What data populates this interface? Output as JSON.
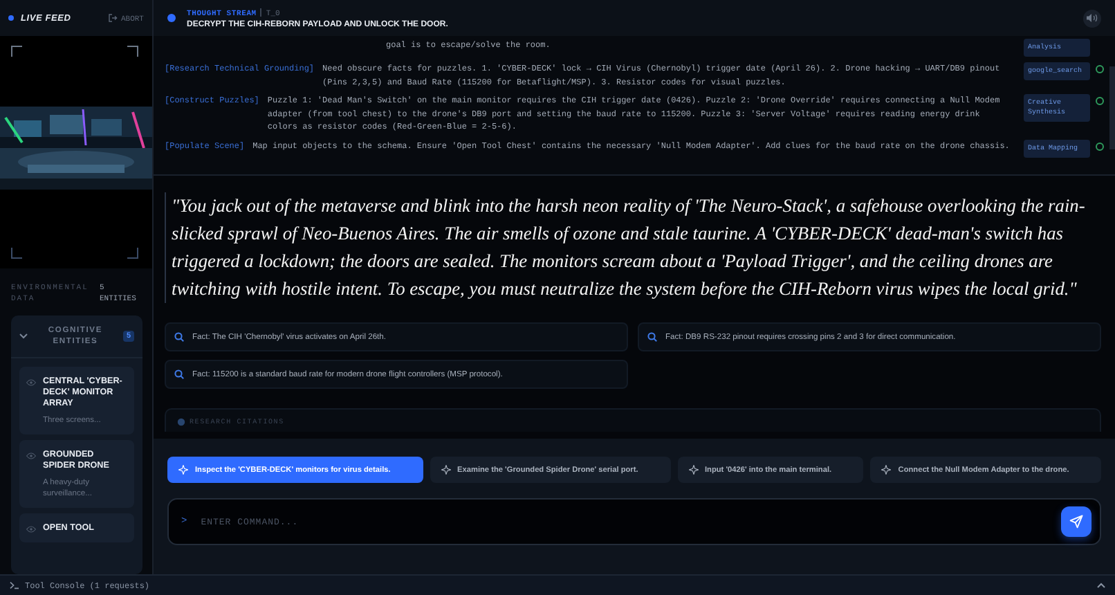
{
  "sidebar": {
    "title": "LIVE FEED",
    "abort": "ABORT",
    "env_label": "ENVIRONMENTAL DATA",
    "env_count": "5 ENTITIES",
    "entities": {
      "title": "COGNITIVE ENTITIES",
      "count": "5",
      "expanded": true,
      "items": [
        {
          "name": "CENTRAL 'CYBER-DECK' MONITOR ARRAY",
          "description": "Three screens..."
        },
        {
          "name": "GROUNDED SPIDER DRONE",
          "description": "A heavy-duty surveillance..."
        },
        {
          "name": "OPEN TOOL"
        }
      ]
    }
  },
  "header": {
    "label": "THOUGHT STREAM",
    "step": "T_0",
    "objective": "DECRYPT THE CIH-REBORN PAYLOAD AND UNLOCK THE DOOR."
  },
  "log": [
    {
      "text": "goal is to escape/solve the room.",
      "tool": "Analysis"
    },
    {
      "tag": "[Research Technical Grounding]",
      "text": "Need obscure facts for puzzles. 1. 'CYBER-DECK' lock → CIH Virus (Chernobyl) trigger date (April 26). 2. Drone hacking → UART/DB9 pinout (Pins 2,3,5) and Baud Rate (115200 for Betaflight/MSP). 3. Resistor codes for visual puzzles.",
      "tool": "google_search",
      "done": true
    },
    {
      "tag": "[Construct Puzzles]",
      "text": "Puzzle 1: 'Dead Man's Switch' on the main monitor requires the CIH trigger date (0426). Puzzle 2: 'Drone Override' requires connecting a Null Modem adapter (from tool chest) to the drone's DB9 port and setting the baud rate to 115200. Puzzle 3: 'Server Voltage' requires reading energy drink colors as resistor codes (Red-Green-Blue = 2-5-6).",
      "tool": "Creative Synthesis",
      "done": true
    },
    {
      "tag": "[Populate Scene]",
      "text": "Map input objects to the schema. Ensure 'Open Tool Chest' contains the necessary 'Null Modem Adapter'. Add clues for the baud rate on the drone chassis.",
      "tool": "Data Mapping",
      "done": true
    }
  ],
  "narrative": "\"You jack out of the metaverse and blink into the harsh neon reality of 'The Neuro-Stack', a safehouse overlooking the rain-slicked sprawl of Neo-Buenos Aires. The air smells of ozone and stale taurine. A 'CYBER-DECK' dead-man's switch has triggered a lockdown; the doors are sealed. The monitors scream about a 'Payload Trigger', and the ceiling drones are twitching with hostile intent. To escape, you must neutralize the system before the CIH-Reborn virus wipes the local grid.\"",
  "facts": [
    "Fact: The CIH 'Chernobyl' virus activates on April 26th.",
    "Fact: DB9 RS-232 pinout requires crossing pins 2 and 3 for direct communication.",
    "Fact: 115200 is a standard baud rate for modern drone flight controllers (MSP protocol)."
  ],
  "citations": {
    "title": "RESEARCH CITATIONS"
  },
  "suggestions": [
    {
      "label": "Inspect the 'CYBER-DECK' monitors for virus details.",
      "selected": true
    },
    {
      "label": "Examine the 'Grounded Spider Drone' serial port.",
      "selected": false
    },
    {
      "label": "Input '0426' into the main terminal.",
      "selected": false
    },
    {
      "label": "Connect the Null Modem Adapter to the drone.",
      "selected": false
    }
  ],
  "command": {
    "prompt": ">",
    "placeholder": "ENTER COMMAND..."
  },
  "status_bar": {
    "label": "Tool Console (1 requests)"
  }
}
